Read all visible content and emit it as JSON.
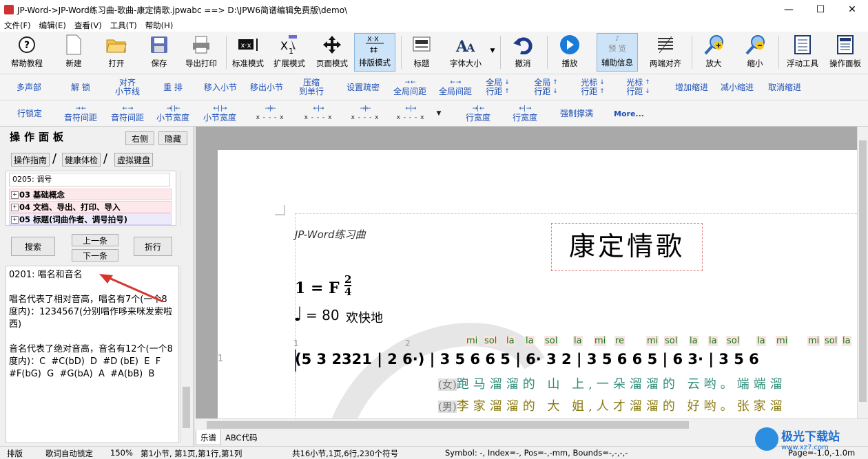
{
  "window": {
    "title": "JP-Word->JP-Word练习曲-歌曲-康定情歌.jpwabc ==> D:\\JPW6简谱编辑免费版\\demo\\",
    "min": "—",
    "max": "☐",
    "close": "✕"
  },
  "menu": [
    "文件(F)",
    "编辑(E)",
    "查看(V)",
    "工具(T)",
    "帮助(H)"
  ],
  "toolbar": [
    "帮助教程",
    "新建",
    "打开",
    "保存",
    "导出打印",
    "标准模式",
    "扩展模式",
    "页面模式",
    "排版模式",
    "标题",
    "字体大小",
    "撤消",
    "播放",
    "辅助信息",
    "两端对齐",
    "放大",
    "缩小",
    "浮动工具",
    "操作面板"
  ],
  "toolbar_preview": "预 览",
  "row2": [
    [
      "多声部"
    ],
    [
      "解 锁"
    ],
    [
      "对齐",
      "小节线"
    ],
    [
      "重 排"
    ],
    [
      "移入小节"
    ],
    [
      "移出小节"
    ],
    [
      "压缩",
      "到单行"
    ],
    [
      "设置疏密"
    ],
    [
      "全局间距"
    ],
    [
      "全局间距"
    ],
    [
      "全局",
      "行距"
    ],
    [
      "全局",
      "行距"
    ],
    [
      "光标",
      "行距"
    ],
    [
      "光标",
      "行距"
    ],
    [
      "增加缩进"
    ],
    [
      "减小缩进"
    ],
    [
      "取消缩进"
    ]
  ],
  "row3": [
    "行锁定",
    "音符间距",
    "音符间距",
    "小节宽度",
    "小节宽度",
    "行宽度",
    "行宽度",
    "强制撑满",
    "More..."
  ],
  "row3_glyph": "x - - - x",
  "panel": {
    "title": "操作面板",
    "right": "右侧",
    "hide": "隐藏",
    "guide": "操作指南",
    "health": "健康体检",
    "keyboard": "虚拟键盘",
    "slash": "/",
    "code": "0205: 调号",
    "nodes": [
      "03 基础概念",
      "04 文档、导出、打印、导入",
      "05 标题(词曲作者、调号拍号)"
    ],
    "search": "搜索",
    "prev": "上一条",
    "next": "下一条",
    "wrap": "折行",
    "help": [
      "0201: 唱名和音名",
      "唱名代表了相对音高，唱名有7个(一个8度内)：1234567(分别唱作哆来咪发索啦西)",
      "音名代表了绝对音高，音名有12个(一个8度内)：C  #C(bD)  D  #D (bE)  E  F  #F(bG)  G  #G(bA)  A  #A(bB)  B"
    ]
  },
  "score": {
    "header": "JP-Word练习曲",
    "title": "康定情歌",
    "key": "1 = F",
    "time_num": "2",
    "time_den": "4",
    "tempo_eq": "= 80",
    "tempo_text": "欢快地",
    "line_no": "1",
    "m1": "1",
    "m2": "2",
    "solfege": [
      "mi",
      "sol",
      "la",
      "la",
      "sol",
      "la",
      "mi",
      "re",
      "mi",
      "sol",
      "la",
      "la",
      "sol",
      "la",
      "mi",
      "mi",
      "sol",
      "la"
    ],
    "notes": "(5 3 2321 | 2 6·) | 3 5 6 6 5 | 6· 3 2 | 3 5 6 6 5 | 6 3· | 3 5 6",
    "lyrics1_tag": "(女)",
    "lyrics1": "跑马溜溜的 山 上,一朵溜溜的 云哟。端端溜",
    "lyrics2_tag": "(男)",
    "lyrics2": "李家溜溜的 大 姐,人才溜溜的 好哟。张家溜"
  },
  "tabs": [
    "乐谱",
    "ABC代码"
  ],
  "status": [
    "排版",
    "歌词自动锁定",
    "150%",
    "第1小节, 第1页,第1行,第1列",
    "共16小节,1页,6行,230个符号",
    "Symbol: -, Index=-, Pos=-,-mm, Bounds=-,-,-,-",
    "Page=-1.0,-1.0m"
  ],
  "watermark": "极光下载站",
  "watermark_url": "www.xz7.com"
}
